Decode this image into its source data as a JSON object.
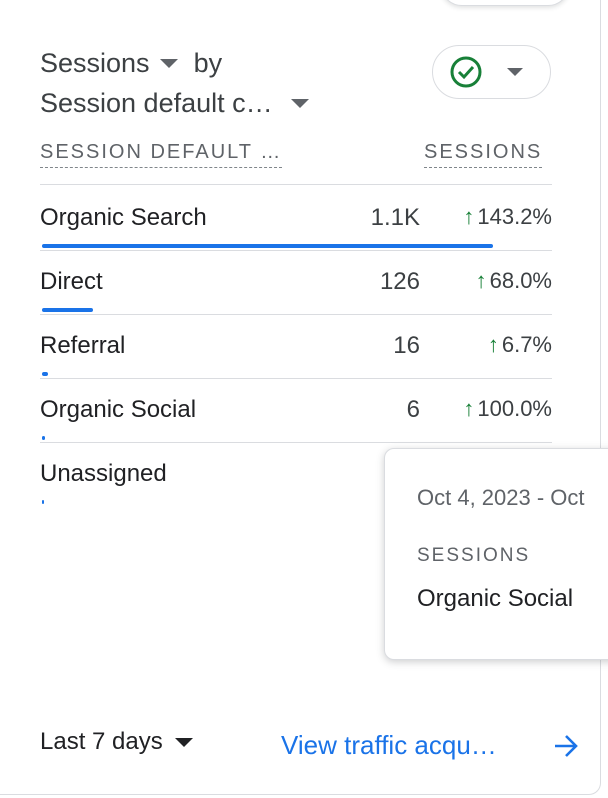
{
  "card": {
    "title_metric": "Sessions",
    "title_by": "by",
    "title_dimension": "Session default c…"
  },
  "table": {
    "dimension_header": "SESSION DEFAULT …",
    "metric_header": "SESSIONS",
    "rows": [
      {
        "label": "Organic Search",
        "value": "1.1K",
        "delta": "143.2%",
        "bar_fraction": 0.88
      },
      {
        "label": "Direct",
        "value": "126",
        "delta": "68.0%",
        "bar_fraction": 0.1
      },
      {
        "label": "Referral",
        "value": "16",
        "delta": "6.7%",
        "bar_fraction": 0.012
      },
      {
        "label": "Organic Social",
        "value": "6",
        "delta": "100.0%",
        "bar_fraction": 0.005
      },
      {
        "label": "Unassigned",
        "value": "",
        "delta": "",
        "bar_fraction": 0.001
      }
    ]
  },
  "tooltip": {
    "date": "Oct 4, 2023 - Oct",
    "metric": "SESSIONS",
    "dimension": "Organic Social"
  },
  "footer": {
    "date_range": "Last 7 days",
    "view_link": "View traffic acqu…"
  },
  "icons": {
    "status": "check-circle-icon",
    "date_dropdown": "caret-down-icon",
    "link": "arrow-right-icon"
  },
  "colors": {
    "accent": "#1a73e8",
    "positive": "#188038",
    "status_check": "#188038"
  }
}
